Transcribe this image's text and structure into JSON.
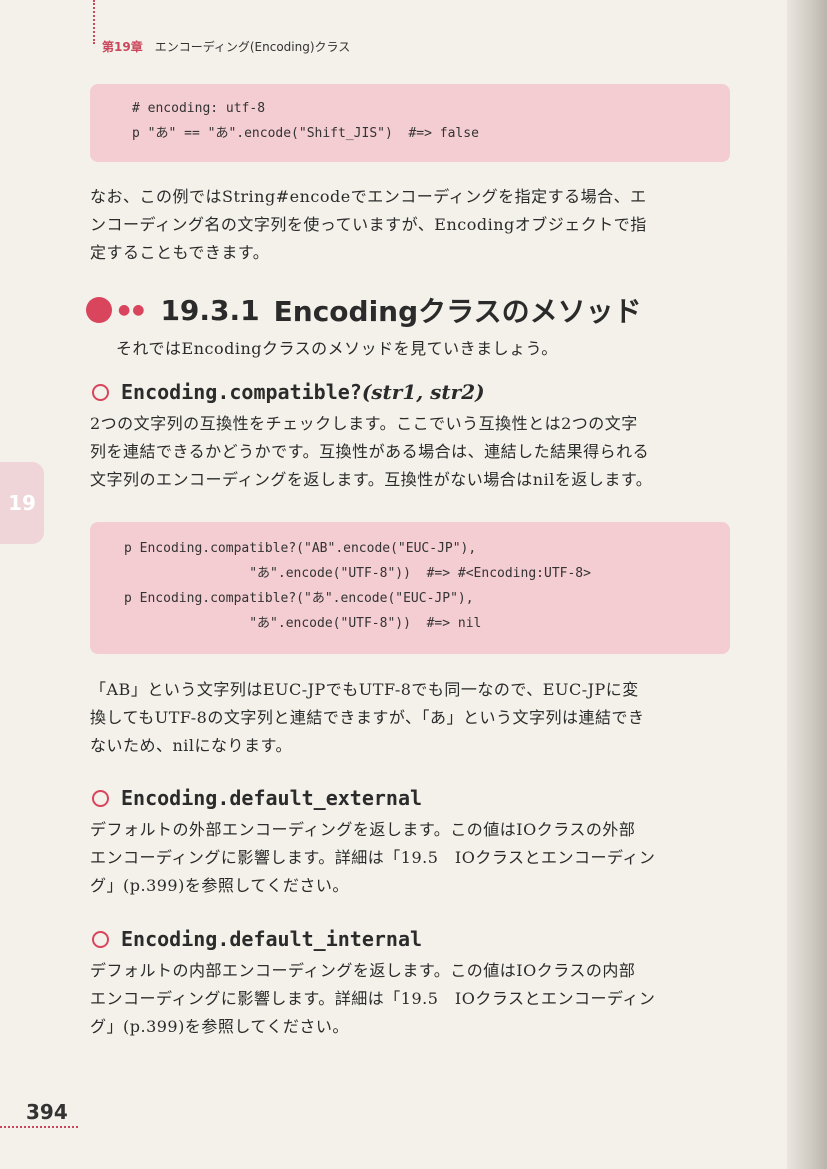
{
  "running_head": {
    "chapter": "第19章",
    "title": "エンコーディング(Encoding)クラス"
  },
  "side_tab": "19",
  "code_block_1": [
    "# encoding: utf-8",
    "p \"あ\" == \"あ\".encode(\"Shift_JIS\")  #=> false"
  ],
  "paragraph_1": [
    "なお、この例ではString#encodeでエンコーディングを指定する場合、エ",
    "ンコーディング名の文字列を使っていますが、Encodingオブジェクトで指",
    "定することもできます。"
  ],
  "section": {
    "number": "19.3.1",
    "title": "Encodingクラスのメソッド"
  },
  "section_intro": "それではEncodingクラスのメソッドを見ていきましょう。",
  "method_1": {
    "name": "Encoding.compatible?",
    "args": "(str1, str2)"
  },
  "method_1_desc": [
    "2つの文字列の互換性をチェックします。ここでいう互換性とは2つの文字",
    "列を連結できるかどうかです。互換性がある場合は、連結した結果得られる",
    "文字列のエンコーディングを返します。互換性がない場合はnilを返します。"
  ],
  "code_block_2": [
    "p Encoding.compatible?(\"AB\".encode(\"EUC-JP\"),",
    "                \"あ\".encode(\"UTF-8\"))  #=> #<Encoding:UTF-8>",
    "p Encoding.compatible?(\"あ\".encode(\"EUC-JP\"),",
    "                \"あ\".encode(\"UTF-8\"))  #=> nil"
  ],
  "paragraph_2": [
    "「AB」という文字列はEUC-JPでもUTF-8でも同一なので、EUC-JPに変",
    "換してもUTF-8の文字列と連結できますが、「あ」という文字列は連結でき",
    "ないため、nilになります。"
  ],
  "method_2": {
    "name": "Encoding.default_external"
  },
  "method_2_desc": [
    "デフォルトの外部エンコーディングを返します。この値はIOクラスの外部",
    "エンコーディングに影響します。詳細は「19.5　IOクラスとエンコーディン",
    "グ」(p.399)を参照してください。"
  ],
  "method_3": {
    "name": "Encoding.default_internal"
  },
  "method_3_desc": [
    "デフォルトの内部エンコーディングを返します。この値はIOクラスの内部",
    "エンコーディングに影響します。詳細は「19.5　IOクラスとエンコーディン",
    "グ」(p.399)を参照してください。"
  ],
  "page_number": "394",
  "colors": {
    "accent": "#d8455c",
    "code_bg": "#f4cdd2",
    "paper": "#f4f1ea"
  }
}
